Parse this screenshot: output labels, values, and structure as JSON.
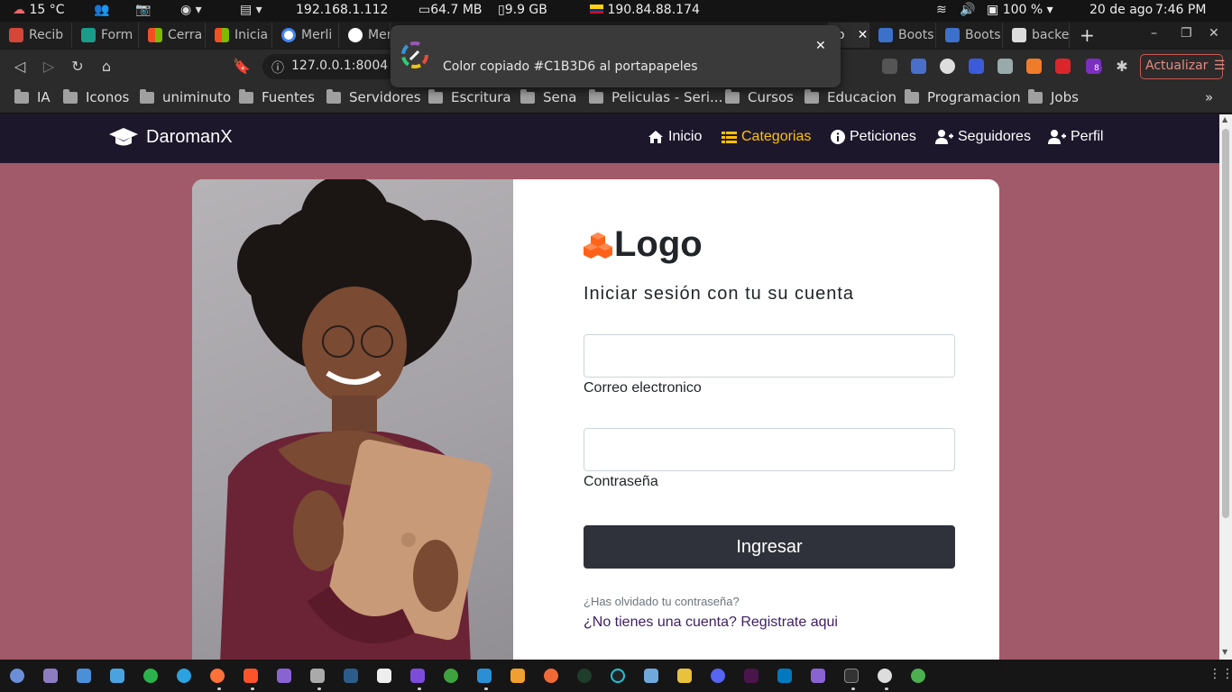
{
  "system_bar": {
    "weather": "15 °C",
    "ip_local": "192.168.1.112",
    "memory": "64.7 MB",
    "disk": "9.9 GB",
    "ip_public": "190.84.88.174",
    "battery": "100 %",
    "date": "20 de ago",
    "time": "7:46 PM"
  },
  "tabs": [
    {
      "label": "Recib",
      "color": "#d44638"
    },
    {
      "label": "Form",
      "color": "#1a9c8a"
    },
    {
      "label": "Cerra",
      "color": "#f25022"
    },
    {
      "label": "Inicia",
      "color": "#f25022"
    },
    {
      "label": "Merli",
      "color": "#ffffff"
    },
    {
      "label": "Mer",
      "color": "#ffffff"
    },
    {
      "label": "o",
      "color": "#888888"
    },
    {
      "label": "Boots",
      "color": "#3b71ca"
    },
    {
      "label": "Boots",
      "color": "#3b71ca"
    },
    {
      "label": "backe",
      "color": "#dddddd"
    }
  ],
  "toolbar": {
    "url": "127.0.0.1:8004",
    "update_label": "Actualizar",
    "extension_badge": "8"
  },
  "bookmarks": [
    "IA",
    "Iconos",
    "uniminuto",
    "Fuentes",
    "Servidores",
    "Escritura",
    "Sena",
    "Peliculas - Seri...",
    "Cursos",
    "Educacion",
    "Programacion",
    "Jobs"
  ],
  "toast": {
    "message": "Color copiado #C1B3D6 al portapapeles"
  },
  "site": {
    "brand": "DaromanX",
    "nav": [
      {
        "label": "Inicio",
        "icon": "home-icon",
        "active": false
      },
      {
        "label": "Categorias",
        "icon": "list-icon",
        "active": true
      },
      {
        "label": "Peticiones",
        "icon": "info-icon",
        "active": false
      },
      {
        "label": "Seguidores",
        "icon": "user-plus-icon",
        "active": false
      },
      {
        "label": "Perfil",
        "icon": "user-plus-icon",
        "active": false
      }
    ],
    "login": {
      "logo_text": "Logo",
      "heading": "Iniciar sesión con tu su cuenta",
      "email_label": "Correo electronico",
      "email_value": "",
      "password_label": "Contraseña",
      "password_value": "",
      "submit_label": "Ingresar",
      "forgot_label": "¿Has olvidado tu contraseña?",
      "register_label": "¿No tienes una cuenta? Registrate aqui"
    }
  },
  "colors": {
    "page_bg": "#a15a69",
    "navbar_bg": "#1d172b",
    "active_nav": "#ffc107",
    "button_bg": "#2f323a",
    "logo_orange": "#ff6219",
    "register_link": "#3f1e63"
  }
}
